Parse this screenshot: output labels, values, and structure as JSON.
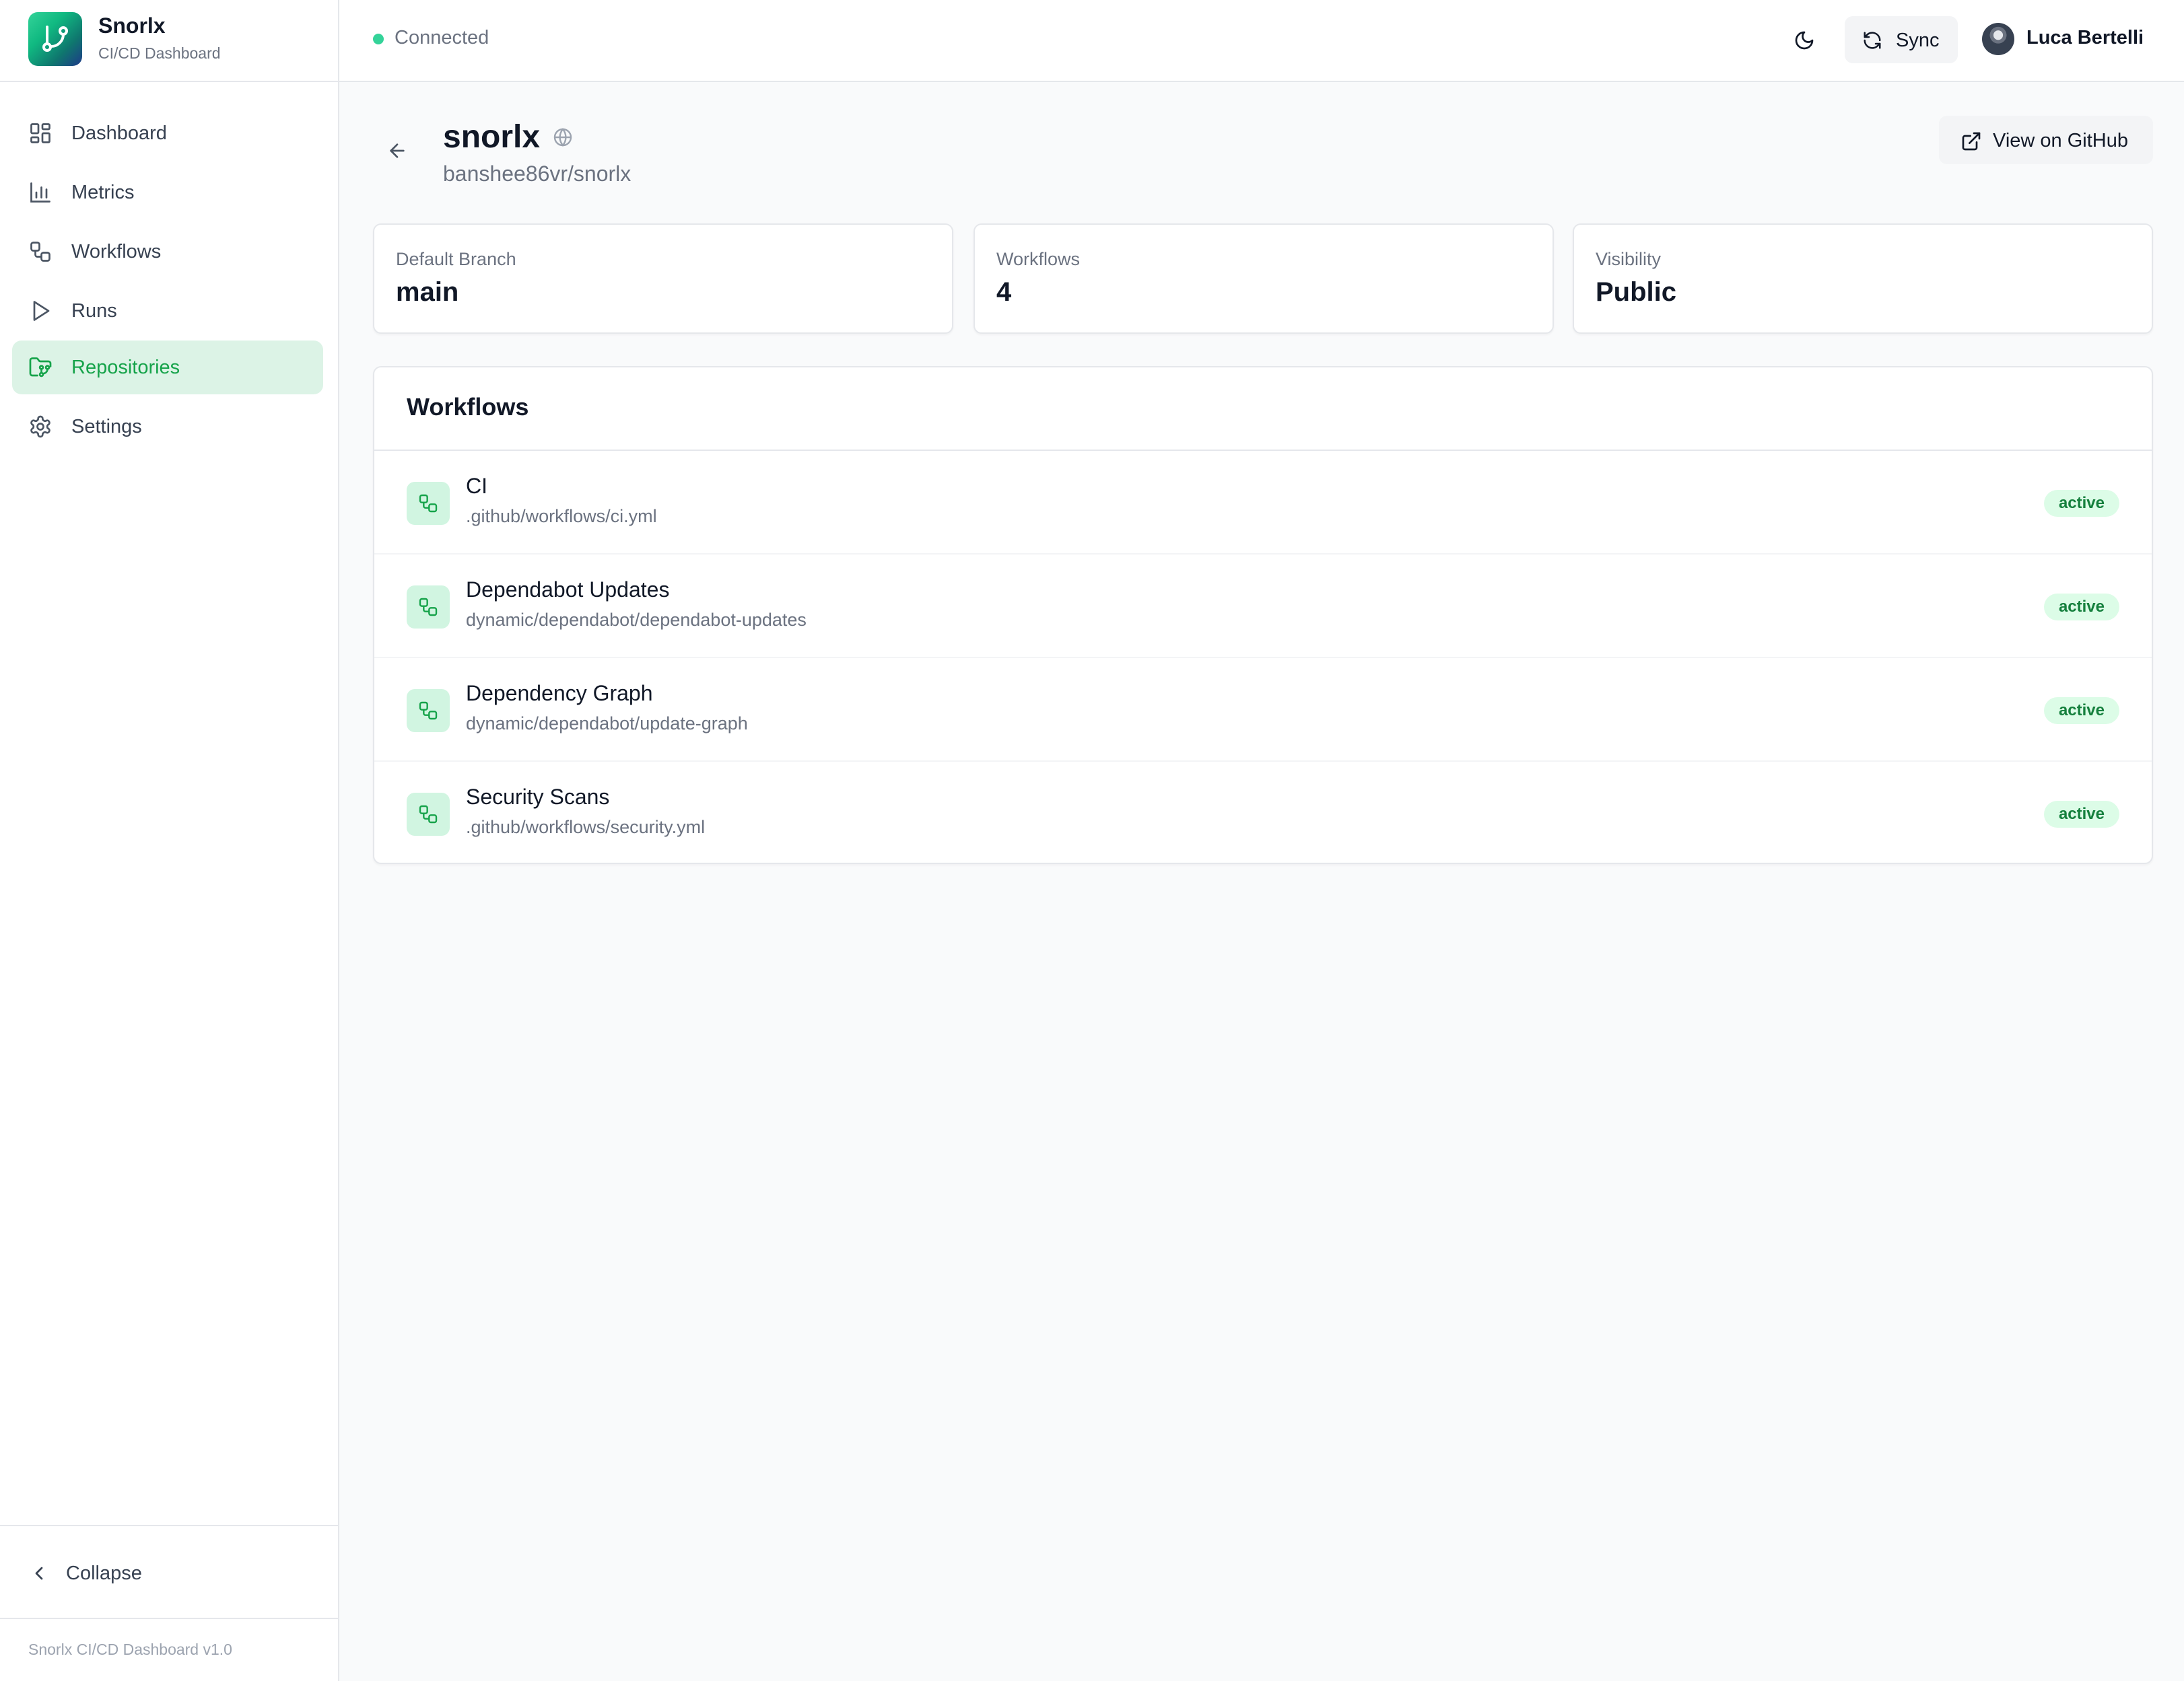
{
  "app": {
    "name": "Snorlx",
    "subtitle": "CI/CD Dashboard",
    "version_label": "Snorlx CI/CD Dashboard v1.0"
  },
  "sidebar": {
    "items": [
      {
        "label": "Dashboard",
        "icon": "dashboard-grid-icon",
        "active": false
      },
      {
        "label": "Metrics",
        "icon": "bar-chart-icon",
        "active": false
      },
      {
        "label": "Workflows",
        "icon": "workflow-icon",
        "active": false
      },
      {
        "label": "Runs",
        "icon": "play-icon",
        "active": false
      },
      {
        "label": "Repositories",
        "icon": "folder-git-icon",
        "active": true
      },
      {
        "label": "Settings",
        "icon": "gear-icon",
        "active": false
      }
    ],
    "collapse_label": "Collapse"
  },
  "header": {
    "status": "Connected",
    "sync_label": "Sync",
    "user_name": "Luca Bertelli"
  },
  "repo": {
    "name": "snorlx",
    "full_name": "banshee86vr/snorlx",
    "github_button": "View on GitHub"
  },
  "stats": [
    {
      "label": "Default Branch",
      "value": "main"
    },
    {
      "label": "Workflows",
      "value": "4"
    },
    {
      "label": "Visibility",
      "value": "Public"
    }
  ],
  "workflows": {
    "title": "Workflows",
    "items": [
      {
        "name": "CI",
        "path": ".github/workflows/ci.yml",
        "status": "active"
      },
      {
        "name": "Dependabot Updates",
        "path": "dynamic/dependabot/dependabot-updates",
        "status": "active"
      },
      {
        "name": "Dependency Graph",
        "path": "dynamic/dependabot/update-graph",
        "status": "active"
      },
      {
        "name": "Security Scans",
        "path": ".github/workflows/security.yml",
        "status": "active"
      }
    ]
  },
  "colors": {
    "accent": "#16a34a",
    "active_nav_bg": "#dcf3e6",
    "status_dot": "#34d399"
  }
}
